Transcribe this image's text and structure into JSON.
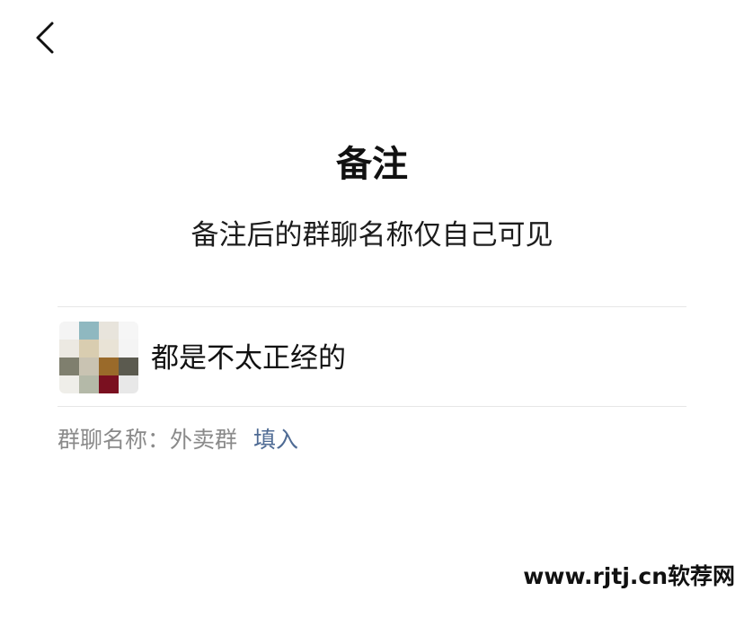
{
  "nav": {
    "back_icon": "chevron-left-icon"
  },
  "header": {
    "title": "备注",
    "subtitle": "备注后的群聊名称仅自己可见"
  },
  "remark": {
    "value": "都是不太正经的",
    "avatar_colors": [
      "#f4f4f4",
      "#8fb8c0",
      "#e8e4dc",
      "#f6f6f6",
      "#ece9e2",
      "#d9cdb0",
      "#e9e3d6",
      "#f4f4f4",
      "#7f7f6e",
      "#c9c3b2",
      "#9a6a2a",
      "#5b5a4f",
      "#efeee9",
      "#b4b9a8",
      "#7a1020",
      "#e8e8e8"
    ]
  },
  "group_name": {
    "label": "群聊名称：",
    "name": "外卖群",
    "fill_label": "填入"
  },
  "watermark": "www.rjtj.cn软荐网",
  "colors": {
    "link": "#4f6b94",
    "muted": "#8a8a8a",
    "divider": "#e6e6e6"
  }
}
